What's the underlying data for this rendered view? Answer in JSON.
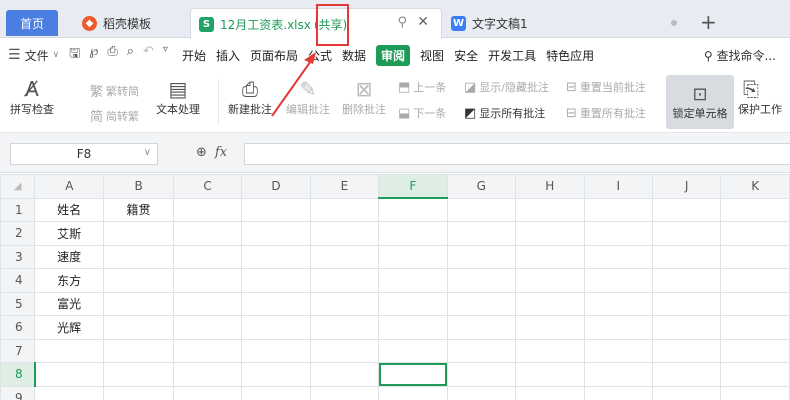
{
  "tabs": {
    "home": "首页",
    "template": "稻壳模板",
    "workbook_title": "12月工资表.xlsx",
    "workbook_shared": "(共享)",
    "doc": "文字文稿1",
    "new_tab": "+",
    "icon_s": "S",
    "icon_w": "W"
  },
  "menu": {
    "file": "文件",
    "items": [
      "开始",
      "插入",
      "页面布局",
      "公式",
      "数据",
      "审阅",
      "视图",
      "安全",
      "开发工具",
      "特色应用"
    ],
    "active_index": 5,
    "search": "查找命令..."
  },
  "ribbon": {
    "spellcheck": "拼写检查",
    "trad": "繁转简",
    "simp": "简转繁",
    "textproc": "文本处理",
    "new_comment": "新建批注",
    "edit_comment": "编辑批注",
    "delete_comment": "删除批注",
    "prev": "上一条",
    "next": "下一条",
    "show_hide": "显示/隐藏批注",
    "show_all": "显示所有批注",
    "reset_current": "重置当前批注",
    "reset_all": "重置所有批注",
    "lock_cell": "锁定单元格",
    "protect": "保护工作"
  },
  "formula": {
    "name_box": "F8",
    "fx": "fx",
    "value": ""
  },
  "sheet": {
    "columns": [
      "A",
      "B",
      "C",
      "D",
      "E",
      "F",
      "G",
      "H",
      "I",
      "J",
      "K"
    ],
    "selected_column": "F",
    "selected_row": 8,
    "rows": [
      {
        "n": "1",
        "A": "姓名",
        "B": "籍贯"
      },
      {
        "n": "2",
        "A": "艾斯",
        "B": ""
      },
      {
        "n": "3",
        "A": "速度",
        "B": ""
      },
      {
        "n": "4",
        "A": "东方",
        "B": ""
      },
      {
        "n": "5",
        "A": "富光",
        "B": ""
      },
      {
        "n": "6",
        "A": "光辉",
        "B": ""
      },
      {
        "n": "7",
        "A": "",
        "B": ""
      },
      {
        "n": "8",
        "A": "",
        "B": ""
      },
      {
        "n": "9",
        "A": "",
        "B": ""
      }
    ]
  },
  "colors": {
    "accent": "#1e9b57",
    "annotation": "#e53935"
  }
}
